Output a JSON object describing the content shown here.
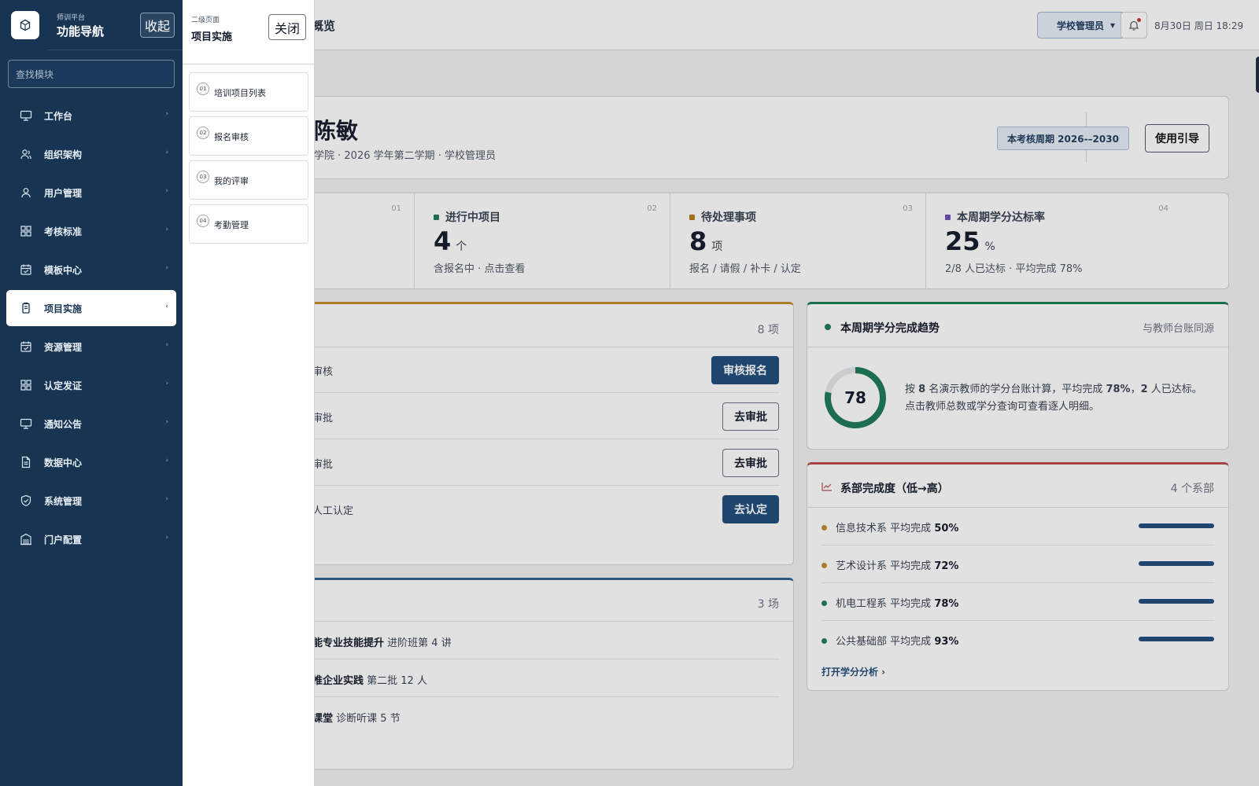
{
  "nav": {
    "subtitle": "师训平台",
    "title": "功能导航",
    "collapse_label": "收起",
    "search_placeholder": "查找模块",
    "items": [
      {
        "label": "工作台",
        "icon": "monitor-icon",
        "chevron": "›"
      },
      {
        "label": "组织架构",
        "icon": "users-icon",
        "chevron": "›"
      },
      {
        "label": "用户管理",
        "icon": "user-icon",
        "chevron": "›"
      },
      {
        "label": "考核标准",
        "icon": "grid-icon",
        "chevron": "›"
      },
      {
        "label": "模板中心",
        "icon": "calendar-check-icon",
        "chevron": "›"
      },
      {
        "label": "项目实施",
        "icon": "clipboard-icon",
        "chevron": "‹",
        "active": true
      },
      {
        "label": "资源管理",
        "icon": "calendar-check-icon",
        "chevron": "›"
      },
      {
        "label": "认定发证",
        "icon": "grid-icon",
        "chevron": "›"
      },
      {
        "label": "通知公告",
        "icon": "monitor-icon",
        "chevron": "›"
      },
      {
        "label": "数据中心",
        "icon": "document-icon",
        "chevron": "›"
      },
      {
        "label": "系统管理",
        "icon": "shield-check-icon",
        "chevron": "›"
      },
      {
        "label": "门户配置",
        "icon": "building-icon",
        "chevron": "›"
      }
    ]
  },
  "subpanel": {
    "kicker": "二级页面",
    "title": "项目实施",
    "close_label": "关闭",
    "items": [
      {
        "num": "01",
        "label": "培训项目列表"
      },
      {
        "num": "02",
        "label": "报名审核"
      },
      {
        "num": "03",
        "label": "我的评审"
      },
      {
        "num": "04",
        "label": "考勤管理"
      }
    ]
  },
  "topbar": {
    "breadcrumb_partial": "概览",
    "role_label": "学校管理员",
    "role_caret": "▾",
    "datetime": "8月30日 周日 18:29"
  },
  "hero": {
    "name_partial": "陈敏",
    "sub_partial": "学院 · 2026 学年第二学期 · 学校管理员",
    "cycle_tag": "本考核周期 2026-–2030",
    "guide_label": "使用引导"
  },
  "stats": [
    {
      "no": "01"
    },
    {
      "no": "02",
      "title": "进行中项目",
      "value": "4",
      "unit": "个",
      "desc": "含报名中 · 点击查看",
      "color": "#1b7a55"
    },
    {
      "no": "03",
      "title": "待处理事项",
      "value": "8",
      "unit": "项",
      "desc": "报名 / 请假 / 补卡 / 认定",
      "color": "#b7791f"
    },
    {
      "no": "04",
      "title": "本周期学分达标率",
      "value": "25",
      "unit": "%",
      "desc": "2/8 人已达标 · 平均完成 78%",
      "color": "#6b4fbb"
    }
  ],
  "todo": {
    "count": "8 项",
    "rows": [
      {
        "text": "审核",
        "action": "审核报名",
        "style": "primary"
      },
      {
        "text": "审批",
        "action": "去审批",
        "style": "ghost"
      },
      {
        "text": "审批",
        "action": "去审批",
        "style": "ghost"
      },
      {
        "text": "人工认定",
        "action": "去认定",
        "style": "primary"
      }
    ]
  },
  "training": {
    "count": "3 场",
    "rows": [
      {
        "bold": "能专业技能提升",
        "rest": "进阶班第 4 讲"
      },
      {
        "bold": "推企业实践",
        "rest": "第二批 12 人"
      },
      {
        "bold": "课堂",
        "rest": "诊断听课 5 节"
      }
    ]
  },
  "trend": {
    "title": "本周期学分完成趋势",
    "source": "与教师台账同源",
    "donut_value": "78",
    "donut_percent": 78,
    "line1_a": "按 ",
    "line1_b": "8",
    "line1_c": " 名演示教师的学分台账计算，平均完成 ",
    "line1_d": "78%",
    "line1_e": "，",
    "line1_f": "2",
    "line1_g": " 人已达标。",
    "line2": "点击教师总数或学分查询可查看逐人明细。",
    "colors": {
      "ring": "#1b7a55",
      "track": "#e5e7eb"
    }
  },
  "dept": {
    "title": "系部完成度（低→高）",
    "count": "4 个系部",
    "prefix": "平均完成",
    "rows": [
      {
        "name": "信息技术系",
        "pct": "50%",
        "dot": "#c48a2c"
      },
      {
        "name": "艺术设计系",
        "pct": "72%",
        "dot": "#c48a2c"
      },
      {
        "name": "机电工程系",
        "pct": "78%",
        "dot": "#1b7a55"
      },
      {
        "name": "公共基础部",
        "pct": "93%",
        "dot": "#1b7a55"
      }
    ],
    "link": "打开学分分析 ›"
  }
}
